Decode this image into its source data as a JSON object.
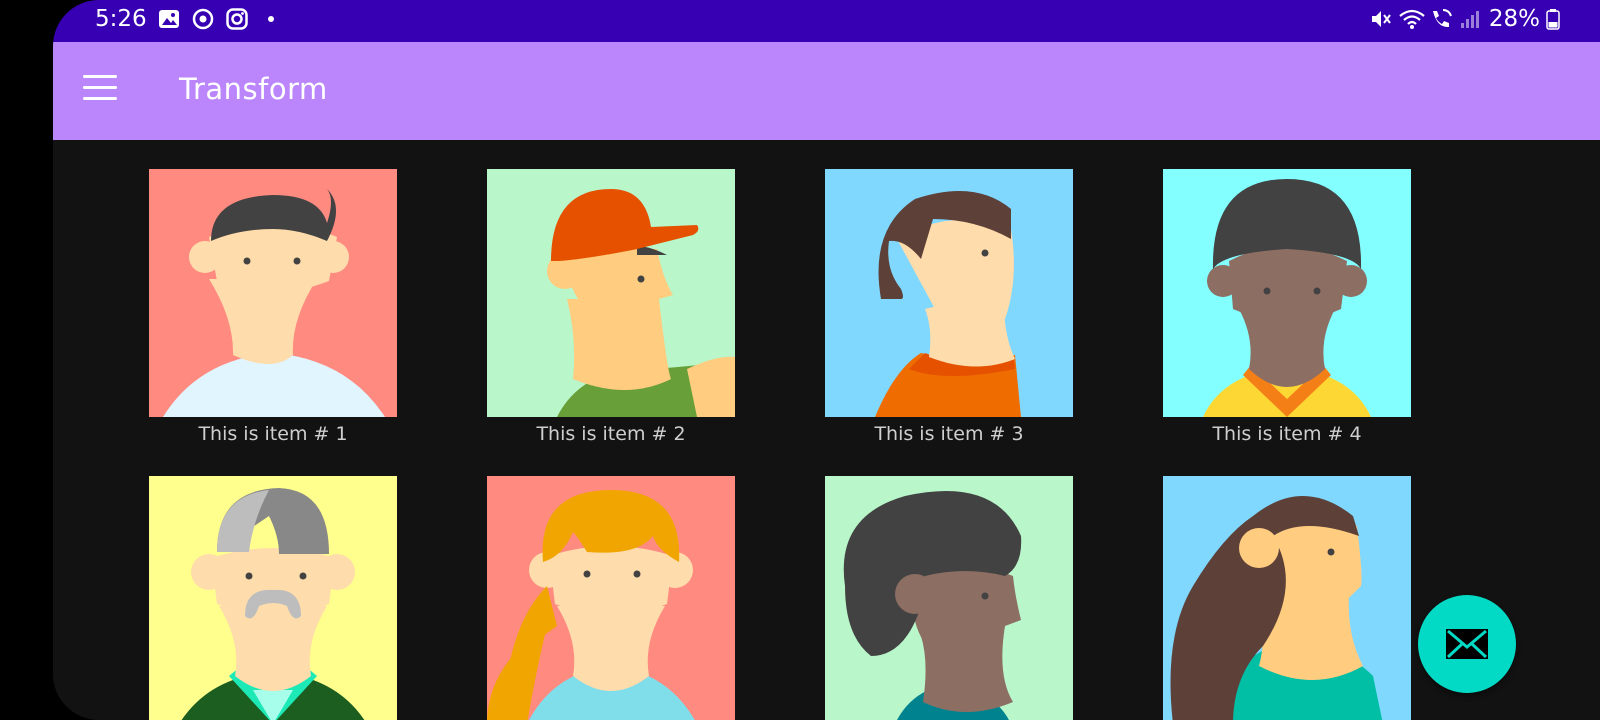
{
  "status_bar": {
    "time": "5:26",
    "battery": "28%",
    "left_icons": [
      "gallery-icon",
      "sync-icon",
      "instagram-icon",
      "notification-dot-icon"
    ],
    "right_icons": [
      "mute-icon",
      "wifi-icon",
      "wifi-call-icon",
      "signal-icon",
      "battery-icon"
    ]
  },
  "app_bar": {
    "title": "Transform",
    "menu_icon": "hamburger-menu-icon"
  },
  "items": [
    {
      "label": "This is item # 1",
      "bg": "#ff8a80"
    },
    {
      "label": "This is item # 2",
      "bg": "#b9f6ca"
    },
    {
      "label": "This is item # 3",
      "bg": "#80d8ff"
    },
    {
      "label": "This is item # 4",
      "bg": "#84ffff"
    },
    {
      "label": "",
      "bg": "#ffff8d"
    },
    {
      "label": "",
      "bg": "#ff8a80"
    },
    {
      "label": "",
      "bg": "#b9f6ca"
    },
    {
      "label": "",
      "bg": "#80d8ff"
    }
  ],
  "fab": {
    "icon": "email-icon",
    "color": "#03dac5"
  },
  "colors": {
    "status_bar": "#3700b3",
    "app_bar": "#bb86fc",
    "background": "#121212"
  }
}
